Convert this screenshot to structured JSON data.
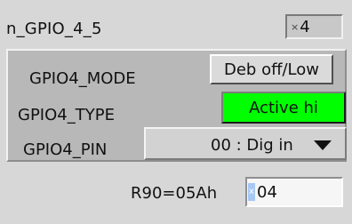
{
  "window": {
    "title": "n_GPIO_4_5"
  },
  "index_field": {
    "marker": "×",
    "value": "4"
  },
  "gpio4": {
    "mode_label": "GPIO4_MODE",
    "mode_value": "Deb off/Low",
    "type_label": "GPIO4_TYPE",
    "type_value": "Active hi",
    "pin_label": "GPIO4_PIN",
    "pin_value": "00 : Dig in"
  },
  "register": {
    "label": "R90=05Ah",
    "marker": "x",
    "value": "04"
  },
  "colors": {
    "panel": "#d7d7d7",
    "section": "#b8b8b8",
    "active_green": "#00ff00",
    "input_bg": "#f6f6f6"
  },
  "icons": {
    "dropdown": "chevron-down-icon"
  }
}
